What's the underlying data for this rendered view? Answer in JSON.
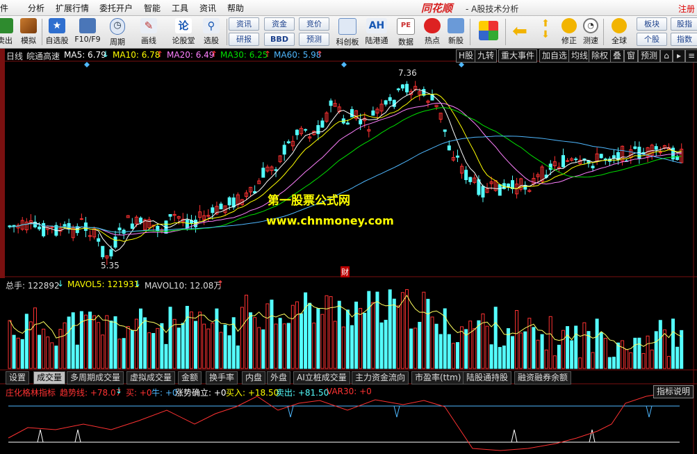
{
  "menu": {
    "items": [
      "分析",
      "扩展行情",
      "委托开户",
      "智能",
      "工具",
      "资讯",
      "帮助"
    ],
    "brand": "同花顺",
    "app_title": "- A股技术分析",
    "register": "注册"
  },
  "toolbar": {
    "buttons": [
      {
        "label": "卖出",
        "icon": "sell-icon"
      },
      {
        "label": "模拟",
        "icon": "hammer-icon"
      },
      {
        "label": "自选股",
        "icon": "star-folder-icon"
      },
      {
        "label": "F10/F9",
        "icon": "f10-icon"
      },
      {
        "label": "周期",
        "icon": "clock-icon"
      },
      {
        "label": "画线",
        "icon": "pencil-icon"
      },
      {
        "label": "论股堂",
        "icon": "discuss-icon"
      },
      {
        "label": "选股",
        "icon": "select-stock-icon"
      },
      {
        "label": "科创板",
        "icon": "star-market-icon"
      },
      {
        "label": "陆港通",
        "icon": "ah-icon"
      },
      {
        "label": "数据",
        "icon": "pe-icon"
      },
      {
        "label": "热点",
        "icon": "hot-icon"
      },
      {
        "label": "新股",
        "icon": "new-stock-icon"
      },
      {
        "label": "修正",
        "icon": "correct-icon"
      },
      {
        "label": "测速",
        "icon": "speed-icon"
      },
      {
        "label": "全球",
        "icon": "globe-icon"
      }
    ],
    "small_buttons": [
      "资讯",
      "资金",
      "竞价",
      "研报",
      "BBD",
      "预测",
      "板块",
      "个股",
      "股指",
      "指数"
    ],
    "ah_text": "AH",
    "pe_text": "PE"
  },
  "header": {
    "period": "日线",
    "stock": "皖通高速",
    "ma5": "MA5: 6.79",
    "ma10": "MA10: 6.78",
    "ma20": "MA20: 6.49",
    "ma30": "MA30: 6.25",
    "ma60": "MA60: 5.98",
    "right_buttons": [
      "H股",
      "九转",
      "重大事件",
      "加自选",
      "均线",
      "除权",
      "叠",
      "窗",
      "预测"
    ]
  },
  "annotations": {
    "high": "7.36",
    "low": "5.35",
    "fin_marker": "财"
  },
  "watermark": {
    "line1": "第一股票公式网",
    "line2": "www.chnmoney.com"
  },
  "volume": {
    "total": "总手: 122892",
    "mavol5": "MAVOL5: 121931",
    "mavol10": "MAVOL10: 12.08万"
  },
  "tabs": [
    "设置",
    "成交量",
    "多周期成交量",
    "虚拟成交量",
    "金额",
    "换手率",
    "内盘",
    "外盘",
    "AI立桩成交量",
    "主力资金流向",
    "市盈率(ttm)",
    "陆股通持股",
    "融资融券余额"
  ],
  "indicator": {
    "name": "庄化格林指标",
    "trend": "趋势线: +78.07",
    "buy": "买: +0",
    "bull": "牛: +0",
    "rise": "涨势确立: +0",
    "buyin": "买入: +18.50",
    "sell": "卖出: +81.50",
    "var30": "VAR30: +0",
    "explain_button": "指标说明"
  },
  "colors": {
    "up": "#ff3232",
    "down": "#54ffff",
    "ma5": "#ffffff",
    "ma10": "#ffff00",
    "ma20": "#ff80ff",
    "ma30": "#00e000",
    "ma60": "#4fb8ff"
  }
}
